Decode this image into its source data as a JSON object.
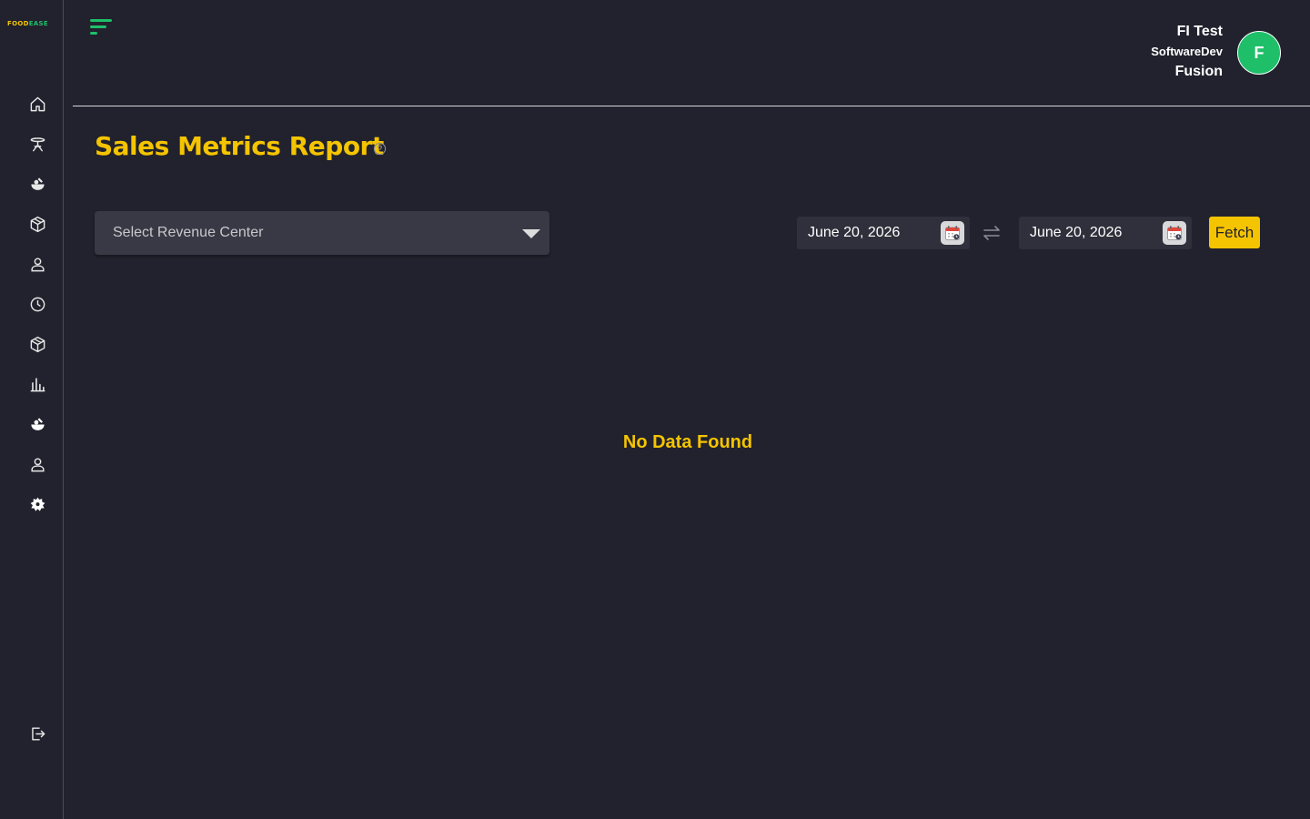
{
  "brand": {
    "logo_part1": "FOOD",
    "logo_part2": "EASE"
  },
  "sidebar": {
    "items": [
      {
        "icon": "home-icon"
      },
      {
        "icon": "dining-table-icon"
      },
      {
        "icon": "food-icon"
      },
      {
        "icon": "package-icon"
      },
      {
        "icon": "user-icon"
      },
      {
        "icon": "clock-icon"
      },
      {
        "icon": "package-icon"
      },
      {
        "icon": "bar-chart-icon"
      },
      {
        "icon": "food-icon"
      },
      {
        "icon": "user-icon"
      },
      {
        "icon": "gear-icon"
      }
    ],
    "logout_icon": "logout-icon"
  },
  "user": {
    "name": "FI Test",
    "org": "SoftwareDev",
    "location": "Fusion",
    "avatar_initial": "F"
  },
  "page": {
    "title": "Sales Metrics Report"
  },
  "filters": {
    "revenue_center_placeholder": "Select Revenue Center",
    "start_date": "June 20, 2026",
    "end_date": "June 20, 2026",
    "fetch_label": "Fetch"
  },
  "empty_state": {
    "message": "No Data Found"
  },
  "colors": {
    "accent_yellow": "#f5c400",
    "accent_green": "#1fbf6a",
    "background": "#21222d",
    "surface": "#383944"
  }
}
